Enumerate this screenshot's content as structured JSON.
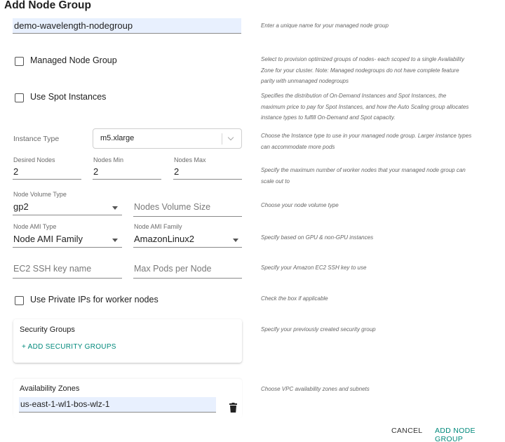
{
  "dialog": {
    "title": "Add Node Group"
  },
  "name_field": {
    "value": "demo-wavelength-nodegroup",
    "help": "Enter a unique name for your managed node group"
  },
  "managed": {
    "label": "Managed Node Group",
    "checked": false,
    "help": "Select to provision optimized groups of nodes- each scoped to a single Availability Zone for your cluster. Note: Managed nodegroups do not have complete feature parity with unmanaged nodegroups"
  },
  "spot": {
    "label": "Use Spot Instances",
    "checked": false,
    "help": "Specifies the distribution of On-Demand Instances and Spot Instances, the maximum price to pay for Spot Instances, and how the Auto Scaling group allocates instance types to fulfill On-Demand and Spot capacity."
  },
  "instance_type": {
    "label": "Instance Type",
    "value": "m5.xlarge",
    "help": "Choose the Instance type to use in your managed node group. Larger instance types can accommodate more pods"
  },
  "nodes": {
    "desired_label": "Desired Nodes",
    "desired_value": "2",
    "min_label": "Nodes Min",
    "min_value": "2",
    "max_label": "Nodes Max",
    "max_value": "2",
    "help": "Specify the maximum number of worker nodes that your managed node group can scale out to"
  },
  "volume": {
    "type_label": "Node Volume Type",
    "type_value": "gp2",
    "size_placeholder": "Nodes Volume Size",
    "help": "Choose your node volume type"
  },
  "ami": {
    "type_label": "Node AMI Type",
    "type_value": "Node AMI Family",
    "family_label": "Node AMI Family",
    "family_value": "AmazonLinux2",
    "help": "Specify based on GPU & non-GPU instances"
  },
  "ssh": {
    "placeholder": "EC2 SSH key name",
    "max_pods_placeholder": "Max Pods per Node",
    "help": "Specify your Amazon EC2 SSH key to use"
  },
  "private_ips": {
    "label": "Use Private IPs for worker nodes",
    "checked": false,
    "help": "Check the box if applicable"
  },
  "security_groups": {
    "title": "Security Groups",
    "add_label": "+ ADD  SECURITY GROUPS",
    "help": "Specify your previously created security group"
  },
  "availability_zones": {
    "title": "Availability Zones",
    "zone_value": "us-east-1-wl1-bos-wlz-1",
    "help": "Choose VPC availability zones and subnets"
  },
  "footer": {
    "cancel_label": "CANCEL",
    "submit_label": "ADD NODE GROUP"
  },
  "colors": {
    "accent": "#00897b",
    "input_fill": "#e8f0fe",
    "text": "#212121"
  }
}
